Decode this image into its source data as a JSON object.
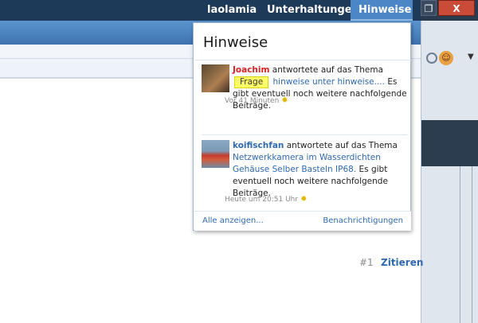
{
  "nav": {
    "user": "laolamia",
    "conversations": "Unterhaltungen",
    "notices": "Hinweise"
  },
  "window": {
    "maximize_icon": "maximize-icon",
    "close_label": "X"
  },
  "popup": {
    "title": "Hinweise",
    "notifications": [
      {
        "user": "Joachim",
        "text_before": "antwortete auf das Thema",
        "badge": "Frage",
        "thread": "hinweise unter hinweise....",
        "text_after": "Es gibt eventuell noch weitere nachfolgende Beiträge.",
        "time": "Vor 41 Minuten"
      },
      {
        "user": "koifischfan",
        "text_before": "antwortete auf das Thema",
        "thread": "Netzwerkkamera im Wasserdichten Gehäuse Selber Basteln IP68.",
        "text_after": "Es gibt eventuell noch weitere nachfolgende Beiträge.",
        "time": "Heute um 20:51 Uhr"
      }
    ],
    "footer_all": "Alle anzeigen...",
    "footer_settings": "Benachrichtigungen"
  },
  "post": {
    "number": "#1",
    "quote": "Zitieren"
  }
}
